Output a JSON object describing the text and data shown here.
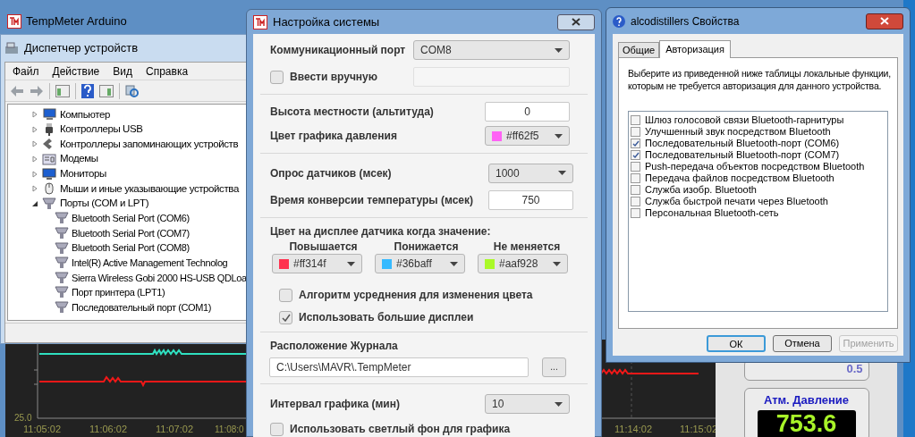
{
  "app_window": {
    "title": "TempMeter Arduino",
    "chart": {
      "y_label": "25.0",
      "time_labels": [
        "11:05:02",
        "11:06:02",
        "11:07:02",
        "11:08:0",
        "11:14:02",
        "11:15:02"
      ]
    },
    "reading_card": {
      "value": "0.5"
    },
    "pressure_card": {
      "title": "Атм. Давление",
      "value": "753.6"
    }
  },
  "device_manager": {
    "title": "Диспетчер устройств",
    "menu": [
      "Файл",
      "Действие",
      "Вид",
      "Справка"
    ],
    "tree": [
      {
        "label": "Компьютер",
        "kind": "computer",
        "expanded": false
      },
      {
        "label": "Контроллеры USB",
        "kind": "usb",
        "expanded": false
      },
      {
        "label": "Контроллеры запоминающих устройств",
        "kind": "storage",
        "expanded": false
      },
      {
        "label": "Модемы",
        "kind": "modem",
        "expanded": false
      },
      {
        "label": "Мониторы",
        "kind": "monitor",
        "expanded": false
      },
      {
        "label": "Мыши и иные указывающие устройства",
        "kind": "mouse",
        "expanded": false
      },
      {
        "label": "Порты (COM и LPT)",
        "kind": "port",
        "expanded": true,
        "children": [
          {
            "label": "Bluetooth Serial Port (COM6)",
            "kind": "port"
          },
          {
            "label": "Bluetooth Serial Port (COM7)",
            "kind": "port"
          },
          {
            "label": "Bluetooth Serial Port (COM8)",
            "kind": "port"
          },
          {
            "label": "Intel(R) Active Management Technolog",
            "kind": "port"
          },
          {
            "label": "Sierra Wireless Gobi 2000 HS-USB QDLoa",
            "kind": "port"
          },
          {
            "label": "Порт принтера (LPT1)",
            "kind": "port"
          },
          {
            "label": "Последовательный порт (COM1)",
            "kind": "port"
          }
        ]
      }
    ]
  },
  "settings_dialog": {
    "title": "Настройка системы",
    "port": {
      "label": "Коммуникационный порт",
      "value": "COM8"
    },
    "manual_entry": {
      "label": "Ввести вручную",
      "checked": false
    },
    "altitude": {
      "label": "Высота местности (альтитуда)",
      "value": "0"
    },
    "pressure_color": {
      "label": "Цвет графика давления",
      "value": "#ff62f5",
      "color": "#ff62f5"
    },
    "polling": {
      "label": "Опрос датчиков (мсек)",
      "value": "1000"
    },
    "conversion_time": {
      "label": "Время конверсии температуры (мсек)",
      "value": "750"
    },
    "display_colors": {
      "heading": "Цвет на дисплее датчика когда значение:",
      "options": [
        {
          "label": "Повышается",
          "value": "#ff314f",
          "color": "#ff314f"
        },
        {
          "label": "Понижается",
          "value": "#36baff",
          "color": "#36baff"
        },
        {
          "label": "Не меняется",
          "value": "#aaf928",
          "color": "#aaf928"
        }
      ]
    },
    "checkboxes": [
      {
        "label": "Алгоритм усреднения для изменения цвета",
        "checked": false
      },
      {
        "label": "Использовать большие дисплеи",
        "checked": true
      }
    ],
    "log_location": {
      "label": "Расположение Журнала",
      "value": "C:\\Users\\MAVR\\.TempMeter",
      "browse": "..."
    },
    "chart_interval": {
      "label": "Интервал графика (мин)",
      "value": "10"
    },
    "light_background": {
      "label": "Использовать светлый фон для графика",
      "checked": false
    }
  },
  "properties_dialog": {
    "title": "alcodistillers Свойства",
    "tabs": [
      {
        "label": "Общие",
        "selected": false
      },
      {
        "label": "Авторизация",
        "selected": true
      }
    ],
    "description": "Выберите из приведенной ниже таблицы локальные функции, которым не требуется авторизация для данного устройства.",
    "services": [
      {
        "label": "Шлюз голосовой связи Bluetooth-гарнитуры",
        "checked": false
      },
      {
        "label": "Улучшенный звук посредством Bluetooth",
        "checked": false
      },
      {
        "label": "Последовательный Bluetooth-порт (COM6)",
        "checked": true
      },
      {
        "label": "Последовательный Bluetooth-порт (COM7)",
        "checked": true
      },
      {
        "label": "Push-передача объектов посредством Bluetooth",
        "checked": false
      },
      {
        "label": "Передача файлов посредством Bluetooth",
        "checked": false
      },
      {
        "label": "Служба изобр. Bluetooth",
        "checked": false
      },
      {
        "label": "Служба быстрой печати через Bluetooth",
        "checked": false
      },
      {
        "label": "Персональная Bluetooth-сеть",
        "checked": false
      }
    ],
    "buttons": [
      {
        "label": "ОК",
        "default": true,
        "disabled": false
      },
      {
        "label": "Отмена",
        "default": false,
        "disabled": false
      },
      {
        "label": "Применить",
        "default": false,
        "disabled": true
      }
    ]
  }
}
